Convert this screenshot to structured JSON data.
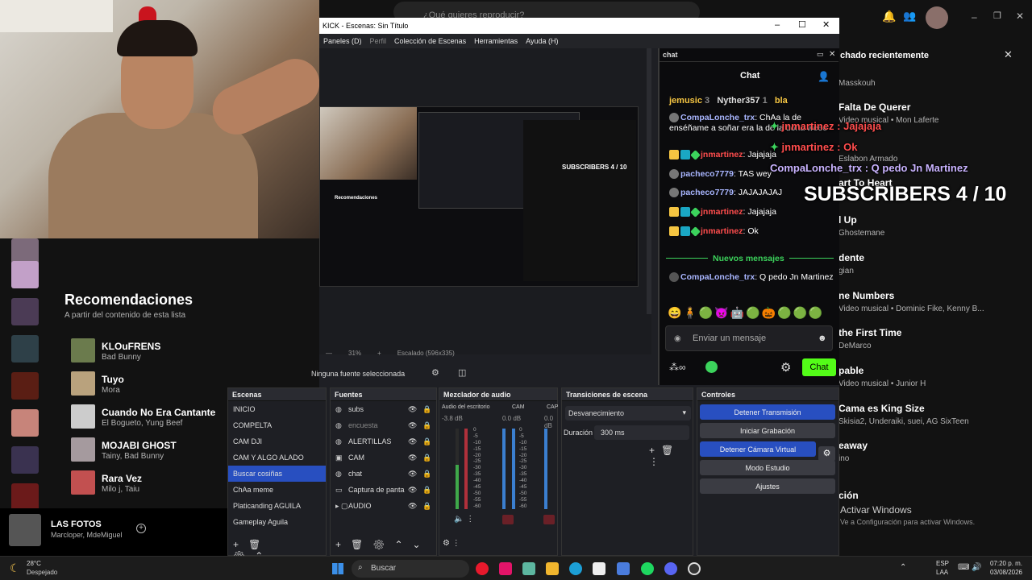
{
  "obs": {
    "title": "KICK - Escenas: Sin Título",
    "menu": [
      "Paneles (D)",
      "Perfil",
      "Colección de Escenas",
      "Herramientas",
      "Ayuda (H)"
    ],
    "zoom": "31%",
    "scale": "Escalado (596x335)",
    "no_source": "Ninguna fuente seleccionada",
    "panels": {
      "escenas": "Escenas",
      "fuentes": "Fuentes",
      "mezclador": "Mezclador de audio",
      "transiciones": "Transiciones de escena",
      "controles": "Controles"
    },
    "scenes": [
      "INICIO",
      "COMPELTA",
      "CAM DJI",
      "CAM Y ALGO ALADO",
      "Buscar cosiñas",
      "ChAa meme",
      "Platicanding AGUILA",
      "Gameplay Aguila"
    ],
    "sources": [
      "subs",
      "encuesta",
      "ALERTILLAS",
      "CAM",
      "chat",
      "Captura de panta",
      "AUDIO"
    ],
    "mixer": {
      "ch1": "Audio del escritorio",
      "ch1_db": "-3.8 dB",
      "ch2": "CAM",
      "ch2_db": "0.0 dB",
      "ch3": "CAP",
      "ch3_db": "0.0 dB",
      "scale": [
        "0",
        "-5",
        "-10",
        "-15",
        "-20",
        "-25",
        "-30",
        "-35",
        "-40",
        "-45",
        "-50",
        "-55",
        "-60"
      ]
    },
    "transition": {
      "type": "Desvanecimiento",
      "duration_label": "Duración",
      "duration": "300 ms"
    },
    "controls": [
      "Detener Transmisión",
      "Iniciar Grabación",
      "Detener Cámara Virtual",
      "Modo Estudio",
      "Ajustes"
    ]
  },
  "chat": {
    "header": "chat",
    "title": "Chat",
    "top": [
      {
        "name": "jemusic",
        "n": "3"
      },
      {
        "name": "Nyther357",
        "n": "1"
      },
      {
        "name": "bla",
        "n": ""
      }
    ],
    "messages": [
      {
        "user": "CompaLonche_trx",
        "text": ": ChAa la de enséñame a soñar era la de la dona weee",
        "color": "b"
      },
      {
        "user": "jnmartinez",
        "text": ": Jajajaja",
        "color": "r"
      },
      {
        "user": "pacheco7779",
        "text": ": TAS wey",
        "color": "b"
      },
      {
        "user": "pacheco7779",
        "text": ": JAJAJAJAJ",
        "color": "b"
      },
      {
        "user": "jnmartinez",
        "text": ": Jajajaja",
        "color": "r"
      },
      {
        "user": "jnmartinez",
        "text": ": Ok",
        "color": "r"
      }
    ],
    "new_messages": "Nuevos mensajes",
    "last": {
      "user": "CompaLonche_trx",
      "text": ": Q pedo Jn Martinez"
    },
    "input_placeholder": "Enviar un mensaje",
    "send": "Chat"
  },
  "overlay": {
    "l1": "jnmartinez : Jajajaja",
    "l2": "jnmartinez : Ok",
    "l3": "CompaLonche_trx : Q pedo Jn Martinez",
    "subs": "SUBSCRIBERS 4 / 10"
  },
  "spotify": {
    "reco_title": "Recomendaciones",
    "reco_sub": "A partir del contenido de esta lista",
    "reco": [
      {
        "title": "KLOuFRENS",
        "artist": "Bad Bunny"
      },
      {
        "title": "Tuyo",
        "artist": "Mora"
      },
      {
        "title": "Cuando No Era Cantante",
        "artist": "El Bogueto, Yung Beef"
      },
      {
        "title": "MOJABI GHOST",
        "artist": "Tainy, Bad Bunny"
      },
      {
        "title": "Rara Vez",
        "artist": "Milo j, Taiu"
      }
    ],
    "now_playing": {
      "title": "LAS FOTOS",
      "artist": "Marcloper, MdeMiguel"
    },
    "search_placeholder": "¿Qué quieres reproducir?",
    "recent_header": "chado recientemente",
    "recent": [
      {
        "title": "",
        "sub": "Masskouh"
      },
      {
        "title": "Falta De Querer",
        "sub": "Video musical • Mon Laferte"
      },
      {
        "title": "",
        "sub": "Eslabon Armado"
      },
      {
        "title": "art To Heart",
        "sub": ""
      },
      {
        "title": "l Up",
        "sub": "Ghostemane"
      },
      {
        "title": "dente",
        "sub": "gian"
      },
      {
        "title": "ne Numbers",
        "sub": "Video musical • Dominic Fike, Kenny B..."
      },
      {
        "title": "the First Time",
        "sub": "DeMarco"
      },
      {
        "title": "pable",
        "sub": "Video musical • Junior H"
      },
      {
        "title": "Cama es King Size",
        "sub": "Skisia2, Underaiki, suei, AG SixTeen"
      },
      {
        "title": "eaway",
        "sub": "ino"
      },
      {
        "title": "ción",
        "sub": ""
      }
    ],
    "activate": "Activar Windows",
    "activate_sub": "Ve a Configuración para activar Windows."
  },
  "taskbar": {
    "weather_temp": "28°C",
    "weather_desc": "Despejado",
    "search": "Buscar",
    "lang": "ESP",
    "lang2": "LAA",
    "time": "07:20 p. m.",
    "date": "03/08/2026"
  }
}
